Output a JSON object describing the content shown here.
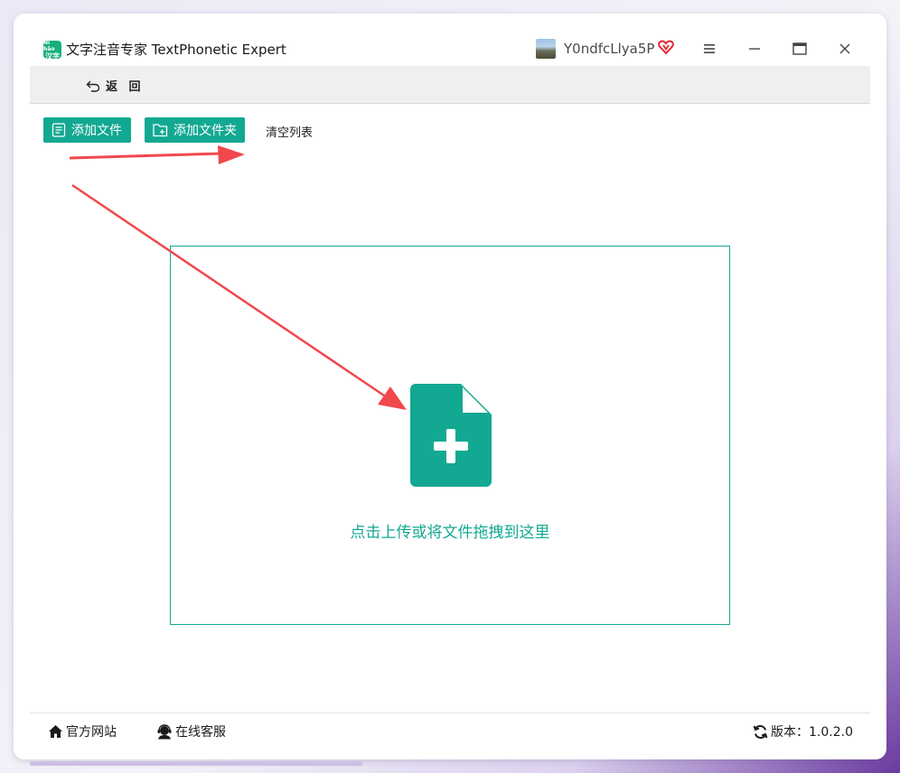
{
  "app": {
    "title": "文字注音专家 TextPhonetic Expert",
    "logo_text_top": "Nǐ hǎo",
    "logo_text_bottom": "汉字",
    "accent_color": "#13a892"
  },
  "user": {
    "name": "Y0ndfcLlya5P"
  },
  "window_controls": {
    "menu_icon": "hamburger-icon",
    "minimize_icon": "minimize-icon",
    "maximize_icon": "maximize-icon",
    "close_icon": "close-icon"
  },
  "nav": {
    "back_label": "返 回"
  },
  "actions": {
    "add_file": "添加文件",
    "add_folder": "添加文件夹",
    "clear_list": "清空列表"
  },
  "dropzone": {
    "label": "点击上传或将文件拖拽到这里"
  },
  "footer": {
    "site": "官方网站",
    "service": "在线客服",
    "version": "版本：1.0.2.0"
  },
  "annotations": {
    "arrow_color": "#f0484d"
  }
}
